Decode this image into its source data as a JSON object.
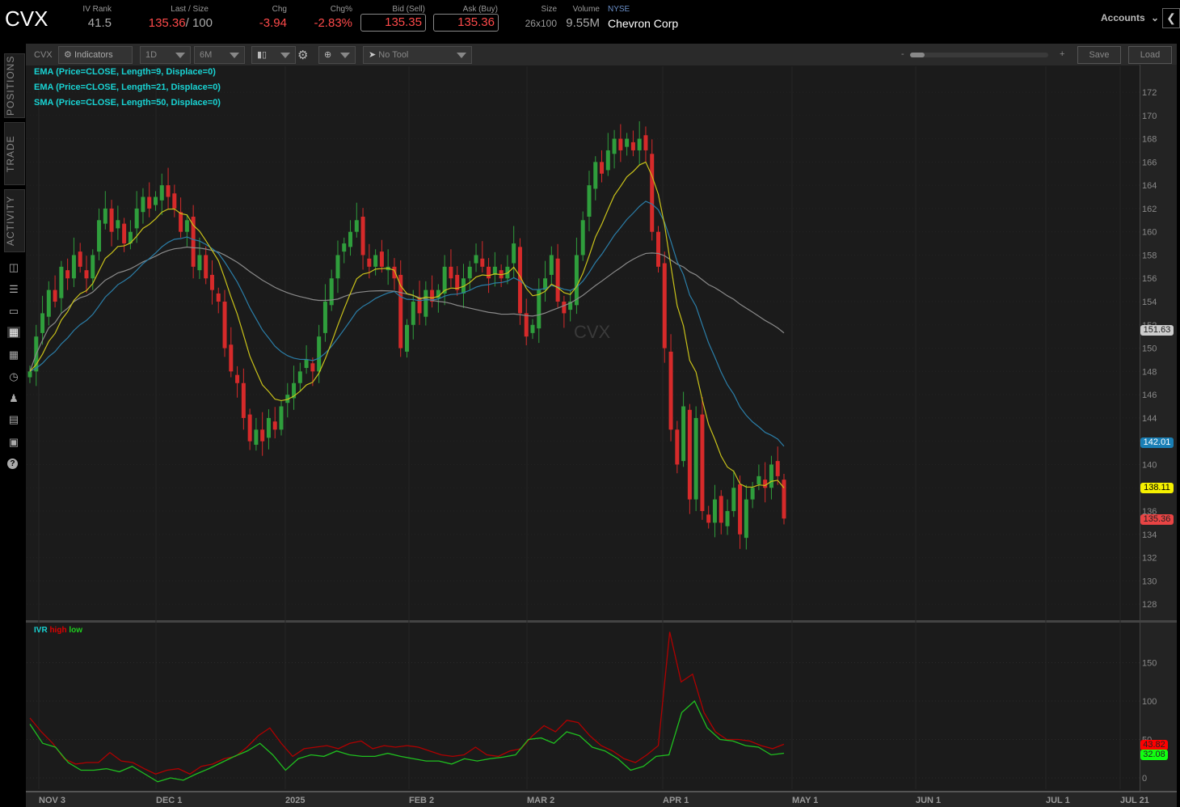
{
  "header": {
    "symbol": "CVX",
    "iv_rank_label": "IV Rank",
    "iv_rank": "41.5",
    "last_size_label": "Last / Size",
    "last": "135.36",
    "size": "/ 100",
    "chg_label": "Chg",
    "chg": "-3.94",
    "chgpct_label": "Chg%",
    "chgpct": "-2.83%",
    "bid_label": "Bid (Sell)",
    "bid": "135.35",
    "ask_label": "Ask (Buy)",
    "ask": "135.36",
    "sz_label": "Size",
    "sz": "26x100",
    "volume_label": "Volume",
    "volume": "9.55M",
    "exchange": "NYSE",
    "company": "Chevron Corp",
    "accounts": "Accounts"
  },
  "toolbar": {
    "symbol": "CVX",
    "indicators": "Indicators",
    "aggregation": "1D",
    "timeframe": "6M",
    "tool": "No Tool",
    "zoom_minus": "-",
    "zoom_plus": "+",
    "zoom_level": 0.05,
    "save": "Save",
    "load": "Load"
  },
  "sidebar": {
    "tabs": [
      "POSITIONS",
      "TRADE",
      "ACTIVITY"
    ]
  },
  "studies": [
    "EMA (Price=CLOSE, Length=9, Displace=0)",
    "EMA (Price=CLOSE, Length=21, Displace=0)",
    "SMA (Price=CLOSE, Length=50, Displace=0)"
  ],
  "watermark": "CVX",
  "ivr": {
    "label": "IVR",
    "high_label": "high",
    "low_label": "low"
  },
  "tags": {
    "sma50": "151.63",
    "ema21": "142.01",
    "ema9": "138.11",
    "last": "135.36",
    "ivr_high": "43.82",
    "ivr_low": "32.08"
  },
  "colors": {
    "up": "#2f9e3c",
    "down": "#d62a2a",
    "ema9": "#c9c21a",
    "ema21": "#2b7ea8",
    "sma50": "#8a8a8a",
    "ivr_high": "#b00000",
    "ivr_low": "#1fbf1f"
  },
  "chart_data": [
    {
      "type": "candlestick",
      "title": "CVX 1D 6M",
      "ylim": [
        127,
        174
      ],
      "yticks": [
        128,
        130,
        132,
        134,
        136,
        138,
        140,
        142,
        144,
        146,
        148,
        150,
        152,
        154,
        156,
        158,
        160,
        162,
        164,
        166,
        168,
        170,
        172
      ],
      "xlabels": [
        "NOV 3",
        "DEC 1",
        "2025",
        "FEB 2",
        "MAR 2",
        "APR 1",
        "MAY 1",
        "JUN 1",
        "JUL 1",
        "JUL 21"
      ],
      "closes": [
        148,
        151,
        153,
        155,
        154,
        157,
        156,
        158,
        157,
        156,
        158,
        161,
        162,
        160,
        161,
        159,
        160,
        162,
        163,
        162,
        163,
        164,
        163,
        162,
        160,
        161,
        157,
        158,
        156,
        155,
        154,
        150,
        148,
        147,
        144,
        142,
        143,
        142,
        144,
        143,
        145,
        146,
        147,
        148,
        149,
        148,
        151,
        154,
        156,
        158,
        159,
        160,
        161,
        158,
        157,
        158,
        157,
        157,
        156,
        150,
        152,
        154,
        153,
        155,
        154,
        155,
        157,
        156,
        155,
        156,
        157,
        158,
        157,
        156,
        157,
        156,
        157,
        159,
        153,
        151,
        152,
        155,
        156,
        158,
        154,
        153,
        154,
        158,
        161,
        164,
        166,
        165,
        167,
        168,
        167,
        168,
        167,
        168,
        167,
        160,
        157,
        150,
        143,
        140,
        145,
        137,
        144,
        136,
        135,
        137,
        135,
        136,
        138,
        134,
        137,
        138,
        139,
        138,
        140,
        139,
        135.36
      ]
    },
    {
      "type": "line",
      "title": "IVR",
      "ylim": [
        -15,
        200
      ],
      "yticks": [
        0,
        50,
        100,
        150
      ],
      "series": [
        {
          "name": "high",
          "values": [
            78,
            60,
            45,
            25,
            18,
            20,
            20,
            33,
            22,
            20,
            12,
            5,
            10,
            12,
            5,
            15,
            18,
            25,
            28,
            40,
            55,
            65,
            45,
            28,
            38,
            40,
            42,
            38,
            45,
            48,
            38,
            42,
            40,
            42,
            40,
            35,
            30,
            28,
            30,
            40,
            30,
            28,
            35,
            38,
            55,
            68,
            60,
            75,
            72,
            55,
            42,
            35,
            25,
            20,
            30,
            42,
            190,
            125,
            135,
            85,
            60,
            50,
            50,
            48,
            42,
            38,
            43.82
          ]
        },
        {
          "name": "low",
          "values": [
            70,
            45,
            40,
            20,
            10,
            10,
            12,
            8,
            15,
            5,
            -5,
            0,
            -3,
            5,
            12,
            20,
            28,
            35,
            45,
            30,
            10,
            25,
            30,
            28,
            35,
            30,
            28,
            28,
            32,
            28,
            25,
            22,
            22,
            18,
            25,
            22,
            25,
            27,
            30,
            50,
            52,
            45,
            60,
            55,
            40,
            35,
            25,
            10,
            15,
            28,
            30,
            85,
            100,
            65,
            50,
            48,
            42,
            40,
            30,
            32.08
          ]
        }
      ]
    }
  ]
}
